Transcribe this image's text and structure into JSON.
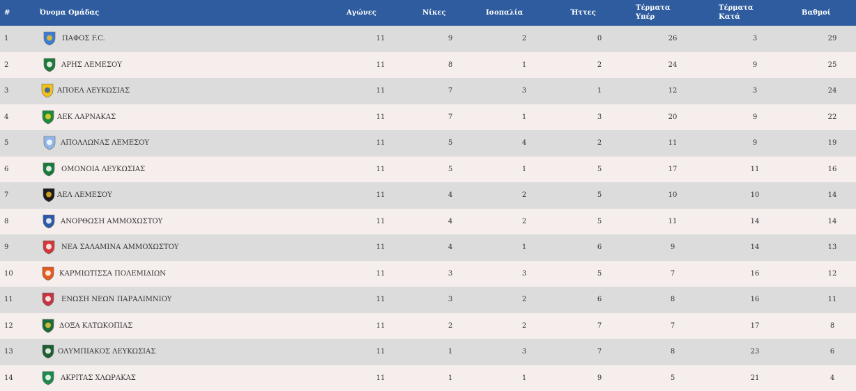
{
  "header": {
    "rank": "#",
    "team": "Όνομα Ομάδας",
    "played": "Αγώνες",
    "wins": "Νίκες",
    "draws": "Ισοπαλία",
    "losses": "Ήττες",
    "goals_for_1": "Τέρματα",
    "goals_for_2": "Υπέρ",
    "goals_against_1": "Τέρματα",
    "goals_against_2": "Κατά",
    "points": "Βαθμοί"
  },
  "colors": {
    "header_bg": "#2e5c9e",
    "row_odd": "#dcdcdc",
    "row_even": "#f6eded"
  },
  "rows": [
    {
      "rank": "1",
      "team": "ΠΑΦΟΣ F.C.",
      "icon": "pafos-fc-logo-icon",
      "played": "11",
      "wins": "9",
      "draws": "2",
      "losses": "0",
      "gf": "26",
      "ga": "3",
      "pts": "29"
    },
    {
      "rank": "2",
      "team": "ΑΡΗΣ ΛΕΜΕΣΟΥ",
      "icon": "aris-limassol-logo-icon",
      "played": "11",
      "wins": "8",
      "draws": "1",
      "losses": "2",
      "gf": "24",
      "ga": "9",
      "pts": "25"
    },
    {
      "rank": "3",
      "team": "ΑΠΟΕΛ ΛΕΥΚΩΣΙΑΣ",
      "icon": "apoel-logo-icon",
      "played": "11",
      "wins": "7",
      "draws": "3",
      "losses": "1",
      "gf": "12",
      "ga": "3",
      "pts": "24"
    },
    {
      "rank": "4",
      "team": "ΑΕΚ ΛΑΡΝΑΚΑΣ",
      "icon": "aek-larnaca-logo-icon",
      "played": "11",
      "wins": "7",
      "draws": "1",
      "losses": "3",
      "gf": "20",
      "ga": "9",
      "pts": "22"
    },
    {
      "rank": "5",
      "team": "ΑΠΟΛΛΩΝΑΣ ΛΕΜΕΣΟΥ",
      "icon": "apollon-logo-icon",
      "played": "11",
      "wins": "5",
      "draws": "4",
      "losses": "2",
      "gf": "11",
      "ga": "9",
      "pts": "19"
    },
    {
      "rank": "6",
      "team": "ΟΜΟΝΟΙΑ ΛΕΥΚΩΣΙΑΣ",
      "icon": "omonia-logo-icon",
      "played": "11",
      "wins": "5",
      "draws": "1",
      "losses": "5",
      "gf": "17",
      "ga": "11",
      "pts": "16"
    },
    {
      "rank": "7",
      "team": "ΑΕΛ ΛΕΜΕΣΟΥ",
      "icon": "ael-logo-icon",
      "played": "11",
      "wins": "4",
      "draws": "2",
      "losses": "5",
      "gf": "10",
      "ga": "10",
      "pts": "14"
    },
    {
      "rank": "8",
      "team": "ΑΝΟΡΘΩΣΗ ΑΜΜΟΧΩΣΤΟΥ",
      "icon": "anorthosis-logo-icon",
      "played": "11",
      "wins": "4",
      "draws": "2",
      "losses": "5",
      "gf": "11",
      "ga": "14",
      "pts": "14"
    },
    {
      "rank": "9",
      "team": "ΝΕΑ ΣΑΛΑΜΙΝΑ ΑΜΜΟΧΩΣΤΟΥ",
      "icon": "nea-salamina-logo-icon",
      "played": "11",
      "wins": "4",
      "draws": "1",
      "losses": "6",
      "gf": "9",
      "ga": "14",
      "pts": "13"
    },
    {
      "rank": "10",
      "team": "ΚΑΡΜΙΩΤΙΣΣΑ ΠΟΛΕΜΙΔΙΩΝ",
      "icon": "karmiotissa-logo-icon",
      "played": "11",
      "wins": "3",
      "draws": "3",
      "losses": "5",
      "gf": "7",
      "ga": "16",
      "pts": "12"
    },
    {
      "rank": "11",
      "team": "ΕΝΩΣΗ ΝΕΩΝ ΠΑΡΑΛΙΜΝΙΟΥ",
      "icon": "enosis-logo-icon",
      "played": "11",
      "wins": "3",
      "draws": "2",
      "losses": "6",
      "gf": "8",
      "ga": "16",
      "pts": "11"
    },
    {
      "rank": "12",
      "team": "ΔΟΞΑ ΚΑΤΩΚΟΠΙΑΣ",
      "icon": "doxa-logo-icon",
      "played": "11",
      "wins": "2",
      "draws": "2",
      "losses": "7",
      "gf": "7",
      "ga": "17",
      "pts": "8"
    },
    {
      "rank": "13",
      "team": "ΟΛΥΜΠΙΑΚΟΣ ΛΕΥΚΩΣΙΑΣ",
      "icon": "olympiakos-nicosia-logo-icon",
      "played": "11",
      "wins": "1",
      "draws": "3",
      "losses": "7",
      "gf": "8",
      "ga": "23",
      "pts": "6"
    },
    {
      "rank": "14",
      "team": "ΑΚΡΙΤΑΣ ΧΛΩΡΑΚΑΣ",
      "icon": "akritas-logo-icon",
      "played": "11",
      "wins": "1",
      "draws": "1",
      "losses": "9",
      "gf": "5",
      "ga": "21",
      "pts": "4"
    }
  ]
}
